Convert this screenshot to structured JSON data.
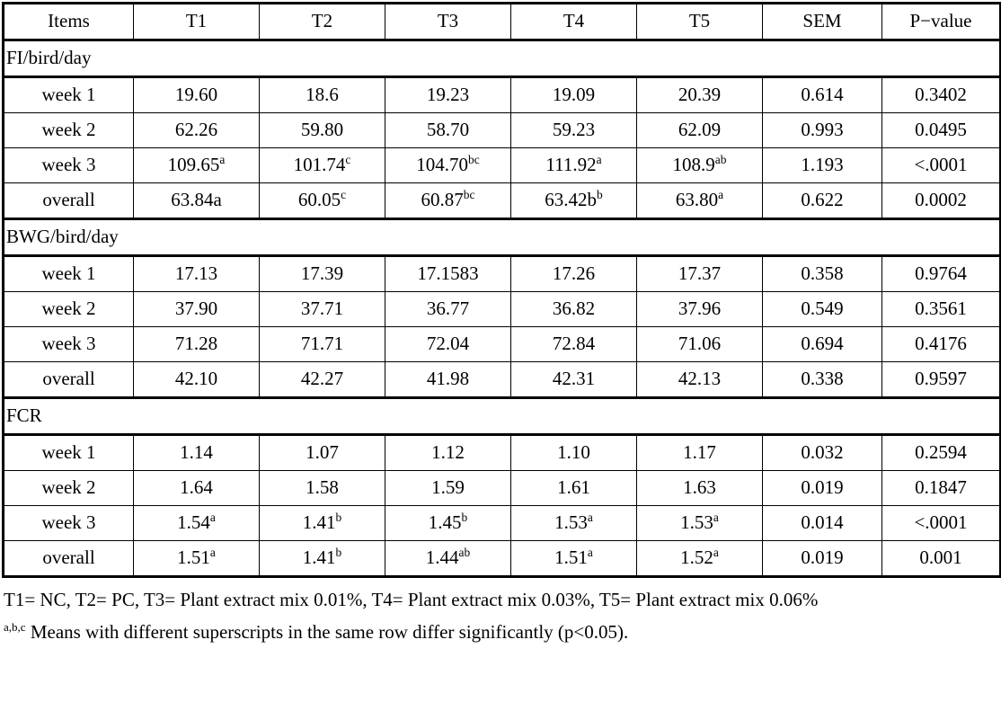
{
  "table": {
    "columns": [
      "Items",
      "T1",
      "T2",
      "T3",
      "T4",
      "T5",
      "SEM",
      "P−value"
    ],
    "sections": [
      {
        "title": "FI/bird/day",
        "rows": [
          {
            "label": "week 1",
            "cells": [
              {
                "value": "19.60",
                "sup": ""
              },
              {
                "value": "18.6",
                "sup": ""
              },
              {
                "value": "19.23",
                "sup": ""
              },
              {
                "value": "19.09",
                "sup": ""
              },
              {
                "value": "20.39",
                "sup": ""
              },
              {
                "value": "0.614",
                "sup": ""
              },
              {
                "value": "0.3402",
                "sup": ""
              }
            ]
          },
          {
            "label": "week 2",
            "cells": [
              {
                "value": "62.26",
                "sup": ""
              },
              {
                "value": "59.80",
                "sup": ""
              },
              {
                "value": "58.70",
                "sup": ""
              },
              {
                "value": "59.23",
                "sup": ""
              },
              {
                "value": "62.09",
                "sup": ""
              },
              {
                "value": "0.993",
                "sup": ""
              },
              {
                "value": "0.0495",
                "sup": ""
              }
            ]
          },
          {
            "label": "week 3",
            "cells": [
              {
                "value": "109.65",
                "sup": "a"
              },
              {
                "value": "101.74",
                "sup": "c"
              },
              {
                "value": "104.70",
                "sup": "bc"
              },
              {
                "value": "111.92",
                "sup": "a"
              },
              {
                "value": "108.9",
                "sup": "ab"
              },
              {
                "value": "1.193",
                "sup": ""
              },
              {
                "value": "<.0001",
                "sup": ""
              }
            ]
          },
          {
            "label": "overall",
            "cells": [
              {
                "value": "63.84a",
                "sup": ""
              },
              {
                "value": "60.05",
                "sup": "c"
              },
              {
                "value": "60.87",
                "sup": "bc"
              },
              {
                "value": "63.42b",
                "sup": "b"
              },
              {
                "value": "63.80",
                "sup": "a"
              },
              {
                "value": "0.622",
                "sup": ""
              },
              {
                "value": "0.0002",
                "sup": ""
              }
            ]
          }
        ]
      },
      {
        "title": "BWG/bird/day",
        "rows": [
          {
            "label": "week 1",
            "cells": [
              {
                "value": "17.13",
                "sup": ""
              },
              {
                "value": "17.39",
                "sup": ""
              },
              {
                "value": "17.1583",
                "sup": ""
              },
              {
                "value": "17.26",
                "sup": ""
              },
              {
                "value": "17.37",
                "sup": ""
              },
              {
                "value": "0.358",
                "sup": ""
              },
              {
                "value": "0.9764",
                "sup": ""
              }
            ]
          },
          {
            "label": "week 2",
            "cells": [
              {
                "value": "37.90",
                "sup": ""
              },
              {
                "value": "37.71",
                "sup": ""
              },
              {
                "value": "36.77",
                "sup": ""
              },
              {
                "value": "36.82",
                "sup": ""
              },
              {
                "value": "37.96",
                "sup": ""
              },
              {
                "value": "0.549",
                "sup": ""
              },
              {
                "value": "0.3561",
                "sup": ""
              }
            ]
          },
          {
            "label": "week 3",
            "cells": [
              {
                "value": "71.28",
                "sup": ""
              },
              {
                "value": "71.71",
                "sup": ""
              },
              {
                "value": "72.04",
                "sup": ""
              },
              {
                "value": "72.84",
                "sup": ""
              },
              {
                "value": "71.06",
                "sup": ""
              },
              {
                "value": "0.694",
                "sup": ""
              },
              {
                "value": "0.4176",
                "sup": ""
              }
            ]
          },
          {
            "label": "overall",
            "cells": [
              {
                "value": "42.10",
                "sup": ""
              },
              {
                "value": "42.27",
                "sup": ""
              },
              {
                "value": "41.98",
                "sup": ""
              },
              {
                "value": "42.31",
                "sup": ""
              },
              {
                "value": "42.13",
                "sup": ""
              },
              {
                "value": "0.338",
                "sup": ""
              },
              {
                "value": "0.9597",
                "sup": ""
              }
            ]
          }
        ]
      },
      {
        "title": "FCR",
        "rows": [
          {
            "label": "week 1",
            "cells": [
              {
                "value": "1.14",
                "sup": ""
              },
              {
                "value": "1.07",
                "sup": ""
              },
              {
                "value": "1.12",
                "sup": ""
              },
              {
                "value": "1.10",
                "sup": ""
              },
              {
                "value": "1.17",
                "sup": ""
              },
              {
                "value": "0.032",
                "sup": ""
              },
              {
                "value": "0.2594",
                "sup": ""
              }
            ]
          },
          {
            "label": "week 2",
            "cells": [
              {
                "value": "1.64",
                "sup": ""
              },
              {
                "value": "1.58",
                "sup": ""
              },
              {
                "value": "1.59",
                "sup": ""
              },
              {
                "value": "1.61",
                "sup": ""
              },
              {
                "value": "1.63",
                "sup": ""
              },
              {
                "value": "0.019",
                "sup": ""
              },
              {
                "value": "0.1847",
                "sup": ""
              }
            ]
          },
          {
            "label": "week 3",
            "cells": [
              {
                "value": "1.54",
                "sup": "a"
              },
              {
                "value": "1.41",
                "sup": "b"
              },
              {
                "value": "1.45",
                "sup": "b"
              },
              {
                "value": "1.53",
                "sup": "a"
              },
              {
                "value": "1.53",
                "sup": "a"
              },
              {
                "value": "0.014",
                "sup": ""
              },
              {
                "value": "<.0001",
                "sup": ""
              }
            ]
          },
          {
            "label": "overall",
            "cells": [
              {
                "value": "1.51",
                "sup": "a"
              },
              {
                "value": "1.41",
                "sup": "b"
              },
              {
                "value": "1.44",
                "sup": "ab"
              },
              {
                "value": "1.51",
                "sup": "a"
              },
              {
                "value": "1.52",
                "sup": "a"
              },
              {
                "value": "0.019",
                "sup": ""
              },
              {
                "value": "0.001",
                "sup": ""
              }
            ]
          }
        ]
      }
    ]
  },
  "footnotes": {
    "treatments": "T1= NC, T2= PC, T3= Plant extract mix 0.01%, T4= Plant extract mix 0.03%, T5= Plant extract mix 0.06%",
    "stats_sup": "a,b,c",
    "stats_text": "Means with different superscripts in the same row differ significantly (p<0.05)."
  }
}
